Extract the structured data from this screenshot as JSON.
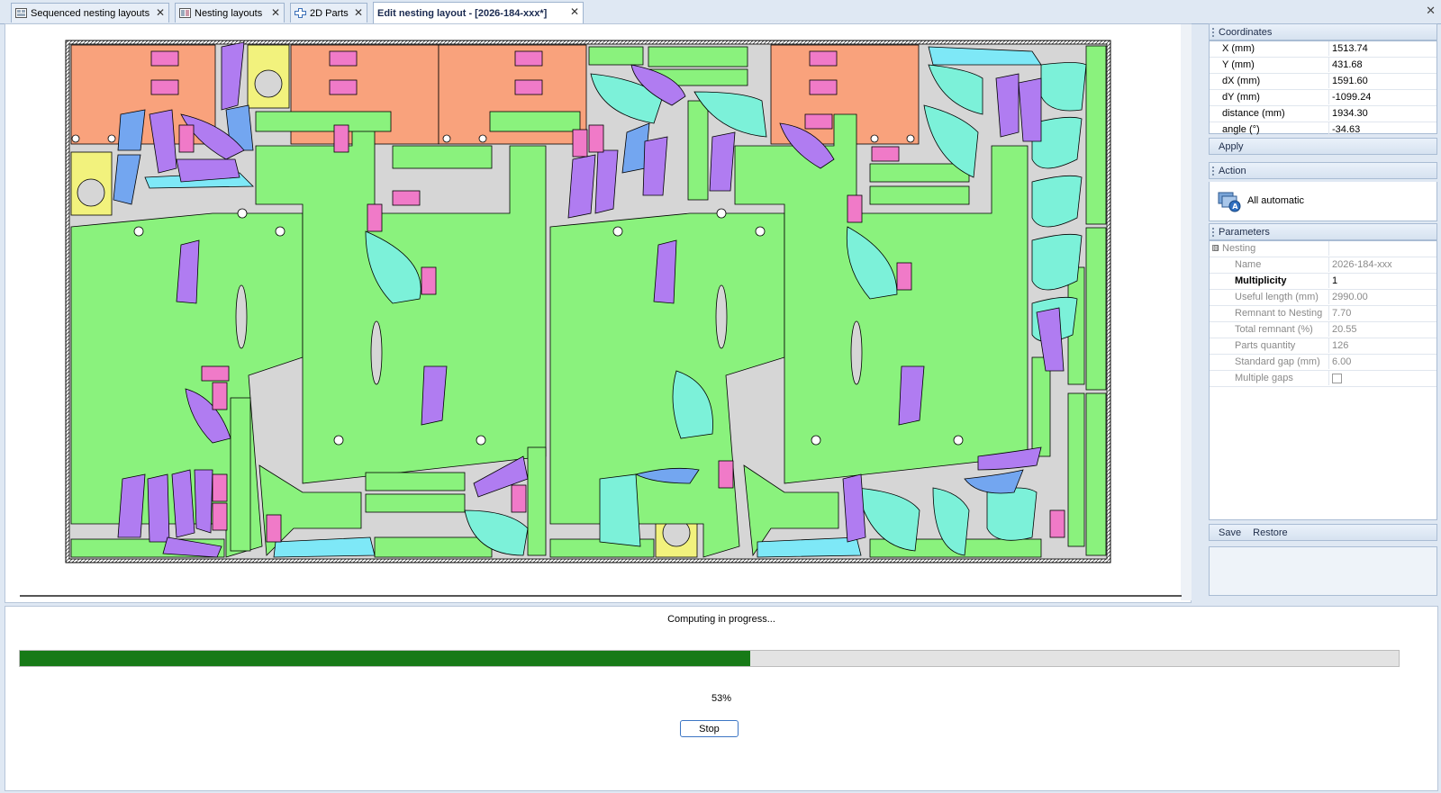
{
  "tabs": [
    {
      "label": "Sequenced nesting layouts",
      "icon": "layout-grid-icon",
      "active": false
    },
    {
      "label": "Nesting layouts",
      "icon": "layout-icon",
      "active": false
    },
    {
      "label": "2D Parts",
      "icon": "part-cross-icon",
      "active": false
    },
    {
      "label": "Edit nesting layout  - [2026-184-xxx*]",
      "icon": "",
      "active": true
    }
  ],
  "coordinates": {
    "title": "Coordinates",
    "rows": [
      {
        "label": "X (mm)",
        "value": "1513.74"
      },
      {
        "label": "Y (mm)",
        "value": "431.68"
      },
      {
        "label": "dX (mm)",
        "value": "1591.60"
      },
      {
        "label": "dY (mm)",
        "value": "-1099.24"
      },
      {
        "label": "distance (mm)",
        "value": "1934.30"
      },
      {
        "label": "angle (°)",
        "value": "-34.63"
      }
    ]
  },
  "apply_label": "Apply",
  "action": {
    "title": "Action",
    "all_automatic_label": "All automatic"
  },
  "parameters": {
    "title": "Parameters",
    "group_label": "Nesting",
    "expander": "⊟",
    "rows": [
      {
        "label": "Name",
        "value": "2026-184-xxx"
      },
      {
        "label": "Multiplicity",
        "value": "1"
      },
      {
        "label": "Useful length (mm)",
        "value": "2990.00"
      },
      {
        "label": "Remnant to Nesting",
        "value": "7.70"
      },
      {
        "label": "Total remnant (%)",
        "value": "20.55"
      },
      {
        "label": "Parts quantity",
        "value": "126"
      },
      {
        "label": "Standard gap (mm)",
        "value": "6.00"
      },
      {
        "label": "Multiple gaps",
        "value": ""
      }
    ]
  },
  "save_label": "Save",
  "restore_label": "Restore",
  "progress": {
    "message": "Computing in  progress...",
    "percent": 53,
    "percent_label": "53%",
    "stop_label": "Stop"
  },
  "colors": {
    "green_part": "#8af27d",
    "orange_part": "#f9a27c",
    "purple_part": "#b07cf1",
    "cyan_part": "#7cf1d9",
    "blue_part": "#73a6f0",
    "yellow_part": "#f2f27d",
    "pink_part": "#f07ac8",
    "light_cyan_part": "#7ee8f7",
    "sheet": "#d6d6d6",
    "progress_fill": "#177a17"
  }
}
